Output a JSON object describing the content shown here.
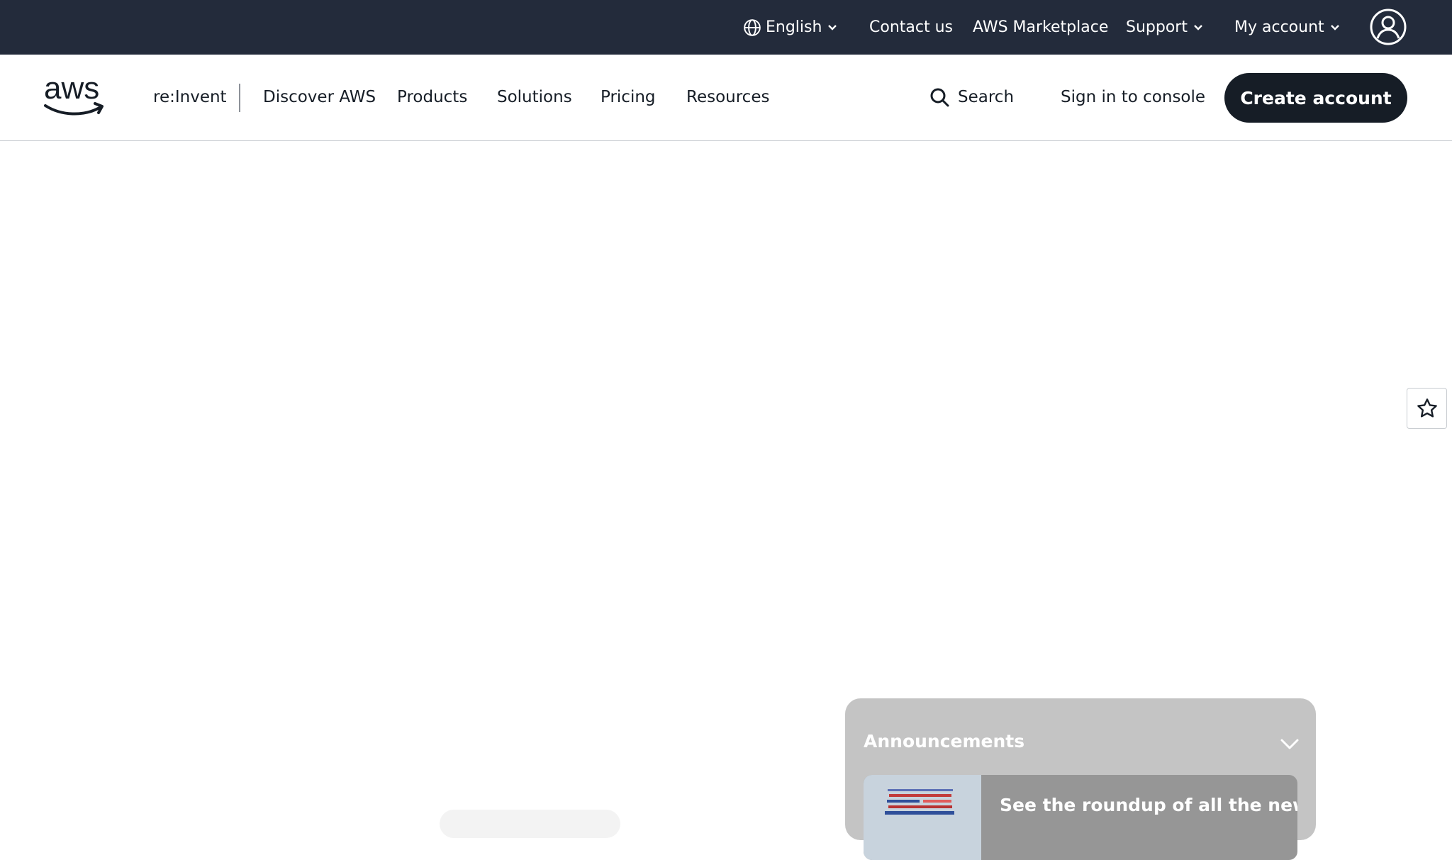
{
  "utility_bar": {
    "language": "English",
    "contact": "Contact us",
    "marketplace": "AWS Marketplace",
    "support": "Support",
    "account": "My account"
  },
  "nav": {
    "logo_text": "aws",
    "items": [
      "re:Invent",
      "Discover AWS",
      "Products",
      "Solutions",
      "Pricing",
      "Resources"
    ],
    "search": "Search",
    "sign_in": "Sign in to console",
    "create_account": "Create account"
  },
  "announcements": {
    "title": "Announcements",
    "card_text": "See the roundup of all the new"
  },
  "colors": {
    "topbar_bg": "#232b3b",
    "primary_button": "#161d26",
    "announce_panel": "#c4c4c4"
  }
}
